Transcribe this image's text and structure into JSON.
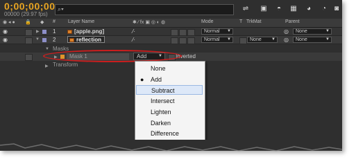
{
  "timecode": "0;00;00;00",
  "fps": "00000 (29.97 fps)",
  "search": {
    "icon": "search-icon"
  },
  "columns": {
    "num": "#",
    "layer_name": "Layer Name",
    "mode": "Mode",
    "t": "T",
    "trkmat": "TrkMat",
    "parent": "Parent"
  },
  "layers": [
    {
      "num": "1",
      "name": "[apple.png]",
      "mode": "Normal",
      "trkmat": "",
      "parent": "None"
    },
    {
      "num": "2",
      "name": "reflection",
      "mode": "Normal",
      "trkmat": "None",
      "parent": "None"
    }
  ],
  "masks_label": "Masks",
  "mask": {
    "name": "Mask 1",
    "mode": "Add",
    "inverted": "Inverted"
  },
  "transform_label": "Transform",
  "menu": {
    "items": [
      "None",
      "Add",
      "Subtract",
      "Intersect",
      "Lighten",
      "Darken",
      "Difference"
    ],
    "selected": "Add",
    "highlighted": "Subtract"
  },
  "colors": {
    "accent_timecode": "#e8a522",
    "annotation": "#cc1e1e",
    "panel": "#2f2f2f"
  }
}
